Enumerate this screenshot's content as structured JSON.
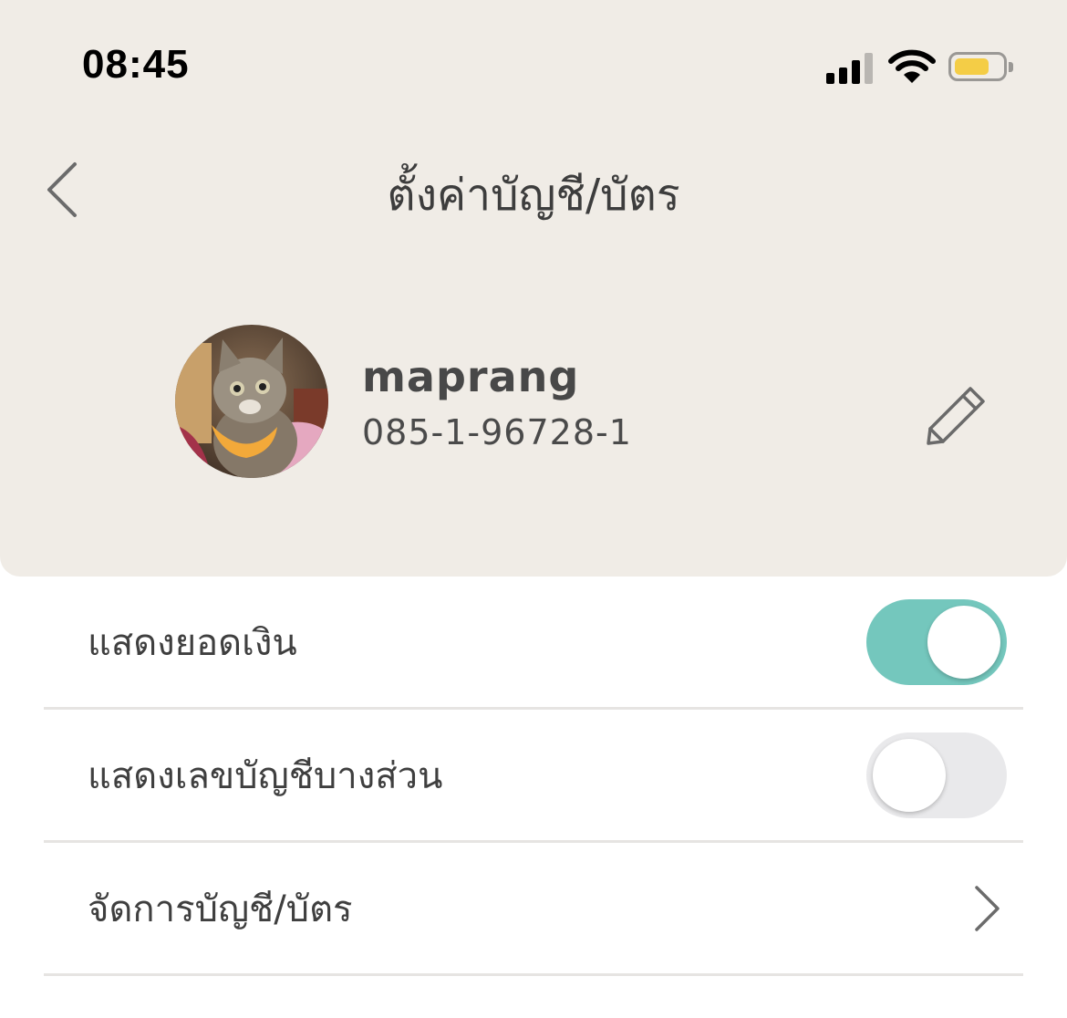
{
  "status_bar": {
    "time": "08:45",
    "battery_level": 0.72
  },
  "nav": {
    "title": "ตั้งค่าบัญชี/บัตร"
  },
  "profile": {
    "name": "maprang",
    "account_number": "085-1-96728-1"
  },
  "settings": {
    "items": [
      {
        "label": "แสดงยอดเงิน",
        "type": "toggle",
        "on": true
      },
      {
        "label": "แสดงเลขบัญชีบางส่วน",
        "type": "toggle",
        "on": false
      },
      {
        "label": "จัดการบัญชี/บัตร",
        "type": "link"
      }
    ]
  },
  "colors": {
    "header_bg": "#f0ece6",
    "toggle_on": "#74c7bd",
    "toggle_off": "#e9e9eb",
    "battery": "#f4cd46"
  },
  "icons": {
    "back": "chevron-left-icon",
    "edit": "pencil-icon",
    "row_link": "chevron-right-icon",
    "signal": "cellular-signal-icon",
    "wifi": "wifi-icon",
    "battery": "battery-icon"
  }
}
